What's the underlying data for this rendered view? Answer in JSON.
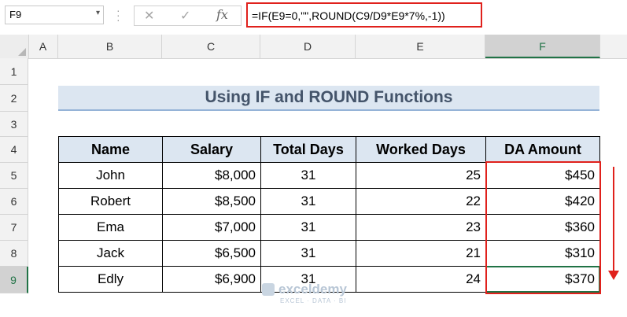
{
  "formula_bar": {
    "name_box": "F9",
    "cancel_icon": "✕",
    "enter_icon": "✓",
    "fx_label": "fx",
    "formula": "=IF(E9=0,\"\",ROUND(C9/D9*E9*7%,-1))"
  },
  "columns": [
    "A",
    "B",
    "C",
    "D",
    "E",
    "F"
  ],
  "rows": [
    "1",
    "2",
    "3",
    "4",
    "5",
    "6",
    "7",
    "8",
    "9"
  ],
  "title": "Using IF and ROUND Functions",
  "table": {
    "headers": [
      "Name",
      "Salary",
      "Total Days",
      "Worked Days",
      "DA Amount"
    ],
    "rows": [
      [
        "John",
        "$8,000",
        "31",
        "25",
        "$450"
      ],
      [
        "Robert",
        "$8,500",
        "31",
        "22",
        "$420"
      ],
      [
        "Ema",
        "$7,000",
        "31",
        "23",
        "$360"
      ],
      [
        "Jack",
        "$6,500",
        "31",
        "21",
        "$310"
      ],
      [
        "Edly",
        "$6,900",
        "31",
        "24",
        "$370"
      ]
    ]
  },
  "watermark": {
    "name": "exceldemy",
    "sub": "EXCEL · DATA · BI"
  },
  "colors": {
    "accent": "#217346",
    "highlight": "#e0211c",
    "header_fill": "#dce6f1"
  }
}
